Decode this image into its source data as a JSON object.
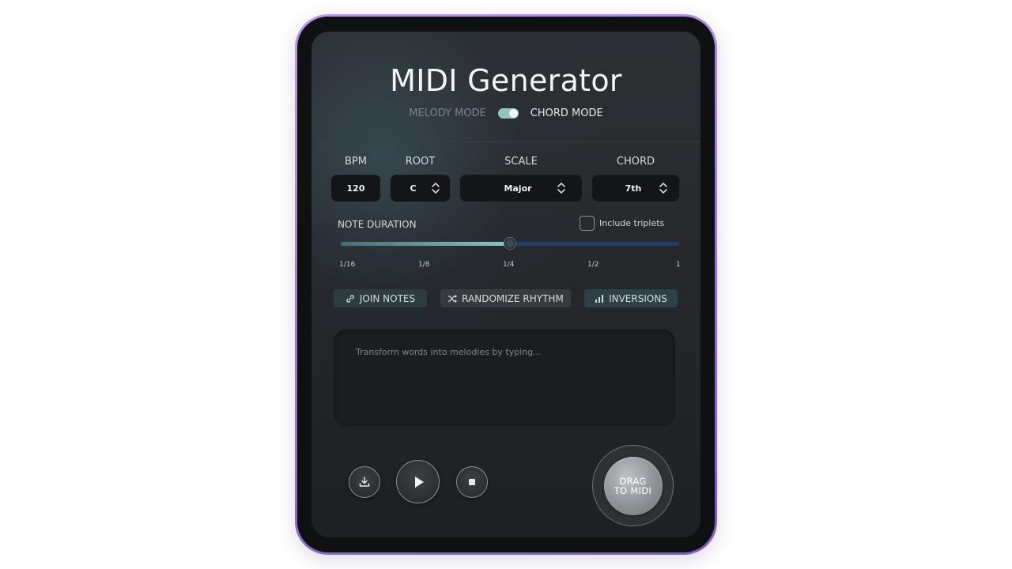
{
  "app": {
    "title": "MIDI Generator"
  },
  "mode": {
    "left_label": "MELODY MODE",
    "right_label": "CHORD MODE",
    "active": "CHORD MODE"
  },
  "fields": {
    "bpm": {
      "label": "BPM",
      "value": "120"
    },
    "root": {
      "label": "ROOT",
      "value": "C"
    },
    "scale": {
      "label": "SCALE",
      "value": "Major"
    },
    "chord": {
      "label": "CHORD",
      "value": "7th"
    }
  },
  "note_duration": {
    "label": "NOTE DURATION",
    "triplets_label": "Include triplets",
    "triplets_checked": false,
    "ticks": [
      "1/16",
      "1/8",
      "1/4",
      "1/2",
      "1"
    ],
    "selected": "1/4",
    "fraction": 0.5
  },
  "chips": {
    "join_notes": "JOIN NOTES",
    "randomize_rhythm": "RANDOMIZE RHYTHM",
    "inversions": "INVERSIONS"
  },
  "input": {
    "placeholder": "Transform words into melodies by typing..."
  },
  "drag_button": {
    "line1": "DRAG",
    "line2": "TO MIDI"
  },
  "colors": {
    "frame_accent": "#9b7fd6",
    "toggle_on": "#8fc7c0",
    "slider_fill": "#8fc7c0",
    "slider_track": "#253d63",
    "chip_join_bg": "#2e3c40",
    "chip_randomize_bg": "#373b3f",
    "chip_inversions_bg": "#2e4146"
  },
  "icons": {
    "join_notes": "link-icon",
    "randomize_rhythm": "shuffle-icon",
    "inversions": "bar-chart-icon",
    "download": "download-icon",
    "play": "play-icon",
    "stop": "stop-icon"
  }
}
